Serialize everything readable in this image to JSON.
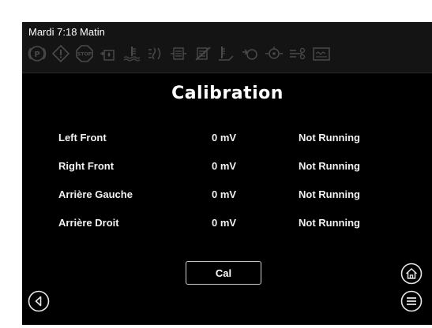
{
  "status_bar": {
    "clock": "Mardi 7:18 Matin",
    "indicators": [
      "parking-brake-icon",
      "warning-icon",
      "stop-icon",
      "fuel-water-icon",
      "coolant-temp-icon",
      "intake-heater-icon",
      "exhaust-filter-icon",
      "exhaust-filter-disabled-icon",
      "exhaust-temp-icon",
      "oil-pressure-icon",
      "engine-warning-icon",
      "transmission-icon",
      "battery-icon"
    ]
  },
  "page": {
    "title": "Calibration"
  },
  "calibration_rows": [
    {
      "name": "Left Front",
      "value": "0 mV",
      "status": "Not Running"
    },
    {
      "name": "Right Front",
      "value": "0 mV",
      "status": "Not Running"
    },
    {
      "name": "Arrière Gauche",
      "value": "0 mV",
      "status": "Not Running"
    },
    {
      "name": "Arrière Droit",
      "value": "0 mV",
      "status": "Not Running"
    }
  ],
  "actions": {
    "cal_label": "Cal"
  },
  "colors": {
    "background": "#000000",
    "status_bar": "#141414",
    "indicator": "#4a4a4a",
    "text": "#ffffff"
  }
}
